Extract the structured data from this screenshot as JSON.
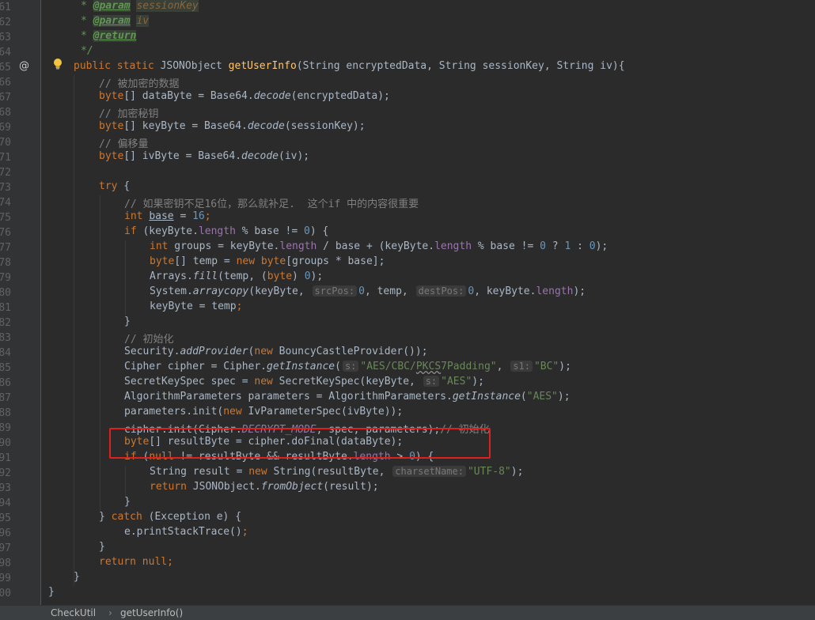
{
  "gutter": {
    "line_numbers": [
      "61",
      "62",
      "63",
      "64",
      "65",
      "66",
      "67",
      "68",
      "69",
      "70",
      "71",
      "72",
      "73",
      "74",
      "75",
      "76",
      "77",
      "78",
      "79",
      "80",
      "81",
      "82",
      "83",
      "84",
      "85",
      "86",
      "87",
      "88",
      "89",
      "90",
      "91",
      "92",
      "93",
      "94",
      "95",
      "96",
      "97",
      "98",
      "99",
      "00"
    ]
  },
  "code": {
    "l61_star": "* ",
    "l61_tag": "@param",
    "l61_val": "sessionKey",
    "l62_star": "* ",
    "l62_tag": "@param",
    "l62_val": "iv",
    "l63_star": "* ",
    "l63_tag": "@return",
    "l64": "*/",
    "l65_kw": "public static ",
    "l65_type": "JSONObject ",
    "l65_fn": "getUserInfo",
    "l65_params": "(String encryptedData, String sessionKey, String iv){",
    "l66": "// 被加密的数据",
    "l67_kw": "byte",
    "l67_a": "[] dataByte = Base64.",
    "l67_m": "decode",
    "l67_b": "(encryptedData);",
    "l68": "// 加密秘钥",
    "l69_kw": "byte",
    "l69_a": "[] keyByte = Base64.",
    "l69_m": "decode",
    "l69_b": "(sessionKey);",
    "l70": "// 偏移量",
    "l71_kw": "byte",
    "l71_a": "[] ivByte = Base64.",
    "l71_m": "decode",
    "l71_b": "(iv);",
    "l73_kw": "try",
    "l73_a": " {",
    "l74": "// 如果密钥不足16位，那么就补足.  这个if 中的内容很重要",
    "l75_kw": "int ",
    "l75_var": "base",
    "l75_a": " = ",
    "l75_num": "16",
    "l75_b": ";",
    "l76_kw": "if",
    "l76_a": " (keyByte.",
    "l76_fld": "length",
    "l76_b": " % base != ",
    "l76_num": "0",
    "l76_c": ") {",
    "l77_kw": "int",
    "l77_a": " groups = keyByte.",
    "l77_fld": "length",
    "l77_b": " / base + (keyByte.",
    "l77_fld2": "length",
    "l77_c": " % base != ",
    "l77_n1": "0",
    "l77_d": " ? ",
    "l77_n2": "1",
    "l77_e": " : ",
    "l77_n3": "0",
    "l77_f": ");",
    "l78_kw": "byte",
    "l78_a": "[] temp = ",
    "l78_kw2": "new byte",
    "l78_b": "[groups * base];",
    "l79_a": "Arrays.",
    "l79_m": "fill",
    "l79_b": "(temp, (",
    "l79_kw": "byte",
    "l79_c": ") ",
    "l79_num": "0",
    "l79_d": ");",
    "l80_a": "System.",
    "l80_m": "arraycopy",
    "l80_b": "(keyByte, ",
    "l80_h1": "srcPos:",
    "l80_n1": "0",
    "l80_c": ", temp, ",
    "l80_h2": "destPos:",
    "l80_n2": "0",
    "l80_d": ", keyByte.",
    "l80_fld": "length",
    "l80_e": ");",
    "l81_a": "keyByte = temp",
    "l81_b": ";",
    "l82": "}",
    "l83": "// 初始化",
    "l84_a": "Security.",
    "l84_m": "addProvider",
    "l84_b": "(",
    "l84_kw": "new",
    "l84_c": " BouncyCastleProvider());",
    "l85_a": "Cipher cipher = Cipher.",
    "l85_m": "getInstance",
    "l85_b": "(",
    "l85_h1": "s:",
    "l85_s1a": "\"AES/CBC/",
    "l85_s1b": "PKCS",
    "l85_s1c": "7Padding\"",
    "l85_c": ", ",
    "l85_h2": "s1:",
    "l85_s2": "\"BC\"",
    "l85_d": ");",
    "l86_a": "SecretKeySpec spec = ",
    "l86_kw": "new",
    "l86_b": " SecretKeySpec(keyByte, ",
    "l86_h": "s:",
    "l86_s": "\"AES\"",
    "l86_c": ");",
    "l87_a": "AlgorithmParameters parameters = AlgorithmParameters.",
    "l87_m": "getInstance",
    "l87_b": "(",
    "l87_s": "\"AES\"",
    "l87_c": ");",
    "l88_a": "parameters.init(",
    "l88_kw": "new",
    "l88_b": " IvParameterSpec(ivByte));",
    "l89_a": "cipher.init(Cipher.",
    "l89_fld": "DECRYPT_MODE",
    "l89_b": ", spec, parameters);",
    "l89_c": "// 初始化",
    "l90_kw": "byte",
    "l90_a": "[] resultByte = cipher.doFinal(dataByte);",
    "l91_kw": "if",
    "l91_a": " (",
    "l91_kw2": "null",
    "l91_b": " != resultByte && resultByte.",
    "l91_fld": "length",
    "l91_c": " > ",
    "l91_num": "0",
    "l91_d": ") {",
    "l92_a": "String result = ",
    "l92_kw": "new",
    "l92_b": " String(resultByte, ",
    "l92_h": "charsetName:",
    "l92_s": "\"UTF-8\"",
    "l92_c": ");",
    "l93_kw": "return",
    "l93_a": " JSONObject.",
    "l93_m": "fromObject",
    "l93_b": "(result);",
    "l94": "}",
    "l95_a": "} ",
    "l95_kw": "catch",
    "l95_b": " (Exception e) {",
    "l96_a": "e.printStackTrace()",
    "l96_b": ";",
    "l97": "}",
    "l98_kw": "return null",
    "l98_a": ";",
    "l99": "}",
    "l100": "}"
  },
  "gutter_icons": {
    "override": "@",
    "bulb": "lightbulb-icon"
  },
  "breadcrumb": {
    "file": "CheckUtil",
    "separator": "›",
    "method": "getUserInfo()"
  },
  "colors": {
    "highlight_box": "#e0201c",
    "background": "#2b2b2b",
    "keyword": "#cc7832"
  }
}
